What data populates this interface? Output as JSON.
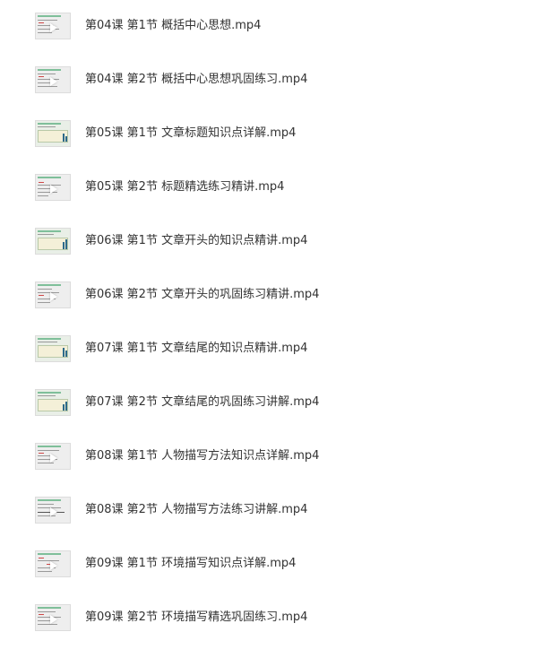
{
  "files": [
    {
      "name": "第04课 第1节 概括中心思想.mp4",
      "icon": "video-thumbnail",
      "style": "text"
    },
    {
      "name": "第04课 第2节 概括中心思想巩固练习.mp4",
      "icon": "video-thumbnail",
      "style": "text"
    },
    {
      "name": "第05课 第1节 文章标题知识点详解.mp4",
      "icon": "video-thumbnail",
      "style": "chart"
    },
    {
      "name": "第05课 第2节 标题精选练习精讲.mp4",
      "icon": "video-thumbnail",
      "style": "text"
    },
    {
      "name": "第06课 第1节 文章开头的知识点精讲.mp4",
      "icon": "video-thumbnail",
      "style": "chart"
    },
    {
      "name": "第06课 第2节 文章开头的巩固练习精讲.mp4",
      "icon": "video-thumbnail",
      "style": "text"
    },
    {
      "name": "第07课 第1节 文章结尾的知识点精讲.mp4",
      "icon": "video-thumbnail",
      "style": "chart"
    },
    {
      "name": "第07课 第2节 文章结尾的巩固练习讲解.mp4",
      "icon": "video-thumbnail",
      "style": "chart"
    },
    {
      "name": "第08课 第1节 人物描写方法知识点详解.mp4",
      "icon": "video-thumbnail",
      "style": "text"
    },
    {
      "name": "第08课 第2节 人物描写方法练习讲解.mp4",
      "icon": "video-thumbnail",
      "style": "text"
    },
    {
      "name": "第09课 第1节 环境描写知识点详解.mp4",
      "icon": "video-thumbnail",
      "style": "text"
    },
    {
      "name": "第09课 第2节 环境描写精选巩固练习.mp4",
      "icon": "video-thumbnail",
      "style": "text"
    }
  ]
}
